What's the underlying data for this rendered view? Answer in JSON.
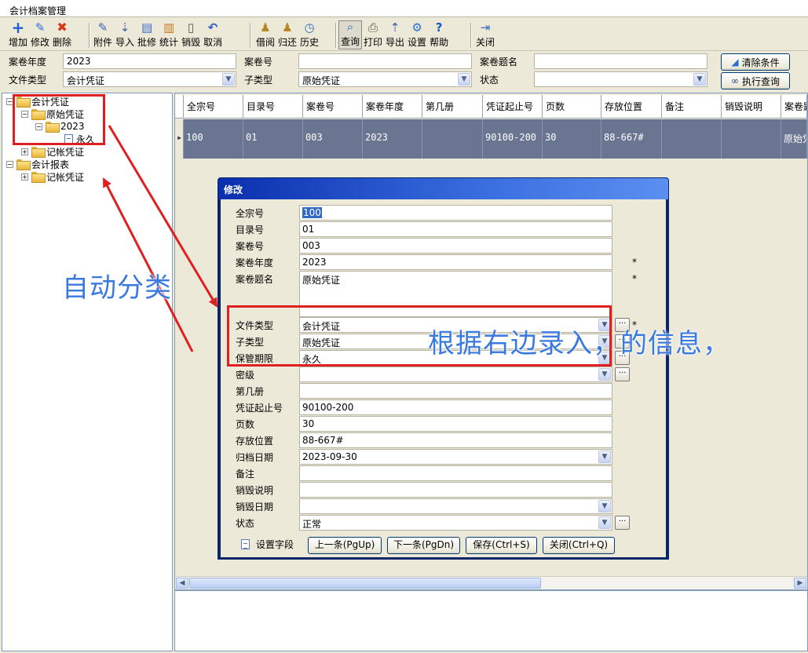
{
  "window": {
    "title": "会计档案管理"
  },
  "toolbar": {
    "items": [
      {
        "label": "增加",
        "icon": "plus-icon"
      },
      {
        "label": "修改",
        "icon": "pencil-icon"
      },
      {
        "label": "删除",
        "icon": "delete-x-icon"
      },
      {
        "label": "附件",
        "icon": "paperclip-icon"
      },
      {
        "label": "导入",
        "icon": "import-icon"
      },
      {
        "label": "批修",
        "icon": "batch-edit-icon"
      },
      {
        "label": "统计",
        "icon": "statistics-icon"
      },
      {
        "label": "销毁",
        "icon": "trash-icon"
      },
      {
        "label": "取消",
        "icon": "undo-icon"
      },
      {
        "label": "借阅",
        "icon": "borrow-icon"
      },
      {
        "label": "归还",
        "icon": "return-icon"
      },
      {
        "label": "历史",
        "icon": "clock-icon"
      },
      {
        "label": "查询",
        "icon": "magnifier-icon"
      },
      {
        "label": "打印",
        "icon": "printer-icon"
      },
      {
        "label": "导出",
        "icon": "export-icon"
      },
      {
        "label": "设置",
        "icon": "settings-icon"
      },
      {
        "label": "帮助",
        "icon": "help-icon"
      },
      {
        "label": "关闭",
        "icon": "exit-icon"
      }
    ]
  },
  "filter": {
    "year_label": "案卷年度",
    "year_value": "2023",
    "file_no_label": "案卷号",
    "file_no_value": "",
    "title_label": "案卷题名",
    "title_value": "",
    "doc_type_label": "文件类型",
    "doc_type_value": "会计凭证",
    "sub_type_label": "子类型",
    "sub_type_value": "原始凭证",
    "status_label": "状态",
    "status_value": "",
    "clear_button": "清除条件",
    "query_button": "执行查询"
  },
  "tree": {
    "nodes": [
      {
        "label": "会计凭证",
        "expander": "−"
      },
      {
        "label": "原始凭证",
        "expander": "−"
      },
      {
        "label": "2023",
        "expander": "−"
      },
      {
        "label": "永久",
        "expander": ""
      },
      {
        "label": "记帐凭证",
        "expander": "+"
      },
      {
        "label": "会计报表",
        "expander": "−"
      },
      {
        "label": "记帐凭证",
        "expander": "+"
      }
    ]
  },
  "grid": {
    "columns": [
      "全宗号",
      "目录号",
      "案卷号",
      "案卷年度",
      "第几册",
      "凭证起止号",
      "页数",
      "存放位置",
      "备注",
      "销毁说明",
      "案卷题"
    ],
    "rows": [
      [
        "100",
        "01",
        "003",
        "2023",
        "",
        "90100-200",
        "30",
        "88-667#",
        "",
        "",
        "原始凭"
      ]
    ]
  },
  "dialog": {
    "title": "修改",
    "fields": [
      {
        "label": "全宗号",
        "value": "100"
      },
      {
        "label": "目录号",
        "value": "01"
      },
      {
        "label": "案卷号",
        "value": "003"
      },
      {
        "label": "案卷年度",
        "value": "2023",
        "required": "*"
      },
      {
        "label": "案卷题名",
        "value": "原始凭证",
        "required": "*"
      },
      {
        "label": "文件类型",
        "value": "会计凭证",
        "required": "*"
      },
      {
        "label": "子类型",
        "value": "原始凭证"
      },
      {
        "label": "保管期限",
        "value": "永久"
      },
      {
        "label": "密级",
        "value": ""
      },
      {
        "label": "第几册",
        "value": ""
      },
      {
        "label": "凭证起止号",
        "value": "90100-200"
      },
      {
        "label": "页数",
        "value": "30"
      },
      {
        "label": "存放位置",
        "value": "88-667#"
      },
      {
        "label": "归档日期",
        "value": "2023-09-30"
      },
      {
        "label": "备注",
        "value": ""
      },
      {
        "label": "销毁说明",
        "value": ""
      },
      {
        "label": "销毁日期",
        "value": ""
      },
      {
        "label": "状态",
        "value": "正常"
      }
    ],
    "ellipsis": "···",
    "set_fields_label": "设置字段",
    "prev_button": "上一条(PgUp)",
    "next_button": "下一条(PgDn)",
    "save_button": "保存(Ctrl+S)",
    "close_button": "关闭(Ctrl+Q)"
  },
  "annotations": {
    "auto_classify": "自动分类",
    "based_on_right": "根据右边录入，的信息，"
  },
  "colors": {
    "annotation_red": "#e02020",
    "annotation_blue": "#3a7ae0",
    "grid_selected_row": "#6a7591",
    "dialog_title": "#0a2fae"
  }
}
